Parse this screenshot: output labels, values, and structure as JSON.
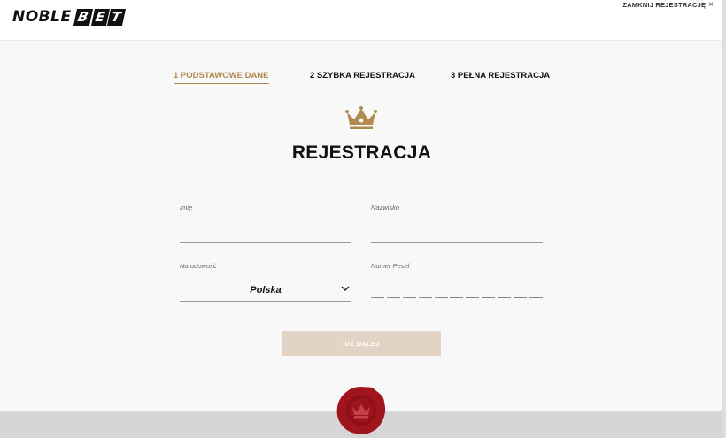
{
  "header": {
    "logo_part1": "NOBLE",
    "logo_part2": [
      "B",
      "E",
      "T"
    ],
    "close_label": "ZAMKNIJ REJESTRACJĘ",
    "close_icon": "×"
  },
  "steps": [
    {
      "label": "1 PODSTAWOWE DANE",
      "active": true
    },
    {
      "label": "2 SZYBKA REJESTRACJA",
      "active": false
    },
    {
      "label": "3 PEŁNA REJESTRACJA",
      "active": false
    }
  ],
  "page_title": "REJESTRACJA",
  "form": {
    "first_name": {
      "label": "Imię",
      "value": ""
    },
    "last_name": {
      "label": "Nazwisko",
      "value": ""
    },
    "nationality": {
      "label": "Narodowość",
      "selected": "Polska"
    },
    "pesel": {
      "label": "Numer Pesel",
      "digits": 11
    }
  },
  "next_button_label": "IDŹ DALEJ",
  "colors": {
    "accent_gold": "#b08a4e",
    "button_disabled": "#e3d3c4",
    "seal_red": "#a0141c",
    "footer_gray": "#d6d6d6"
  }
}
